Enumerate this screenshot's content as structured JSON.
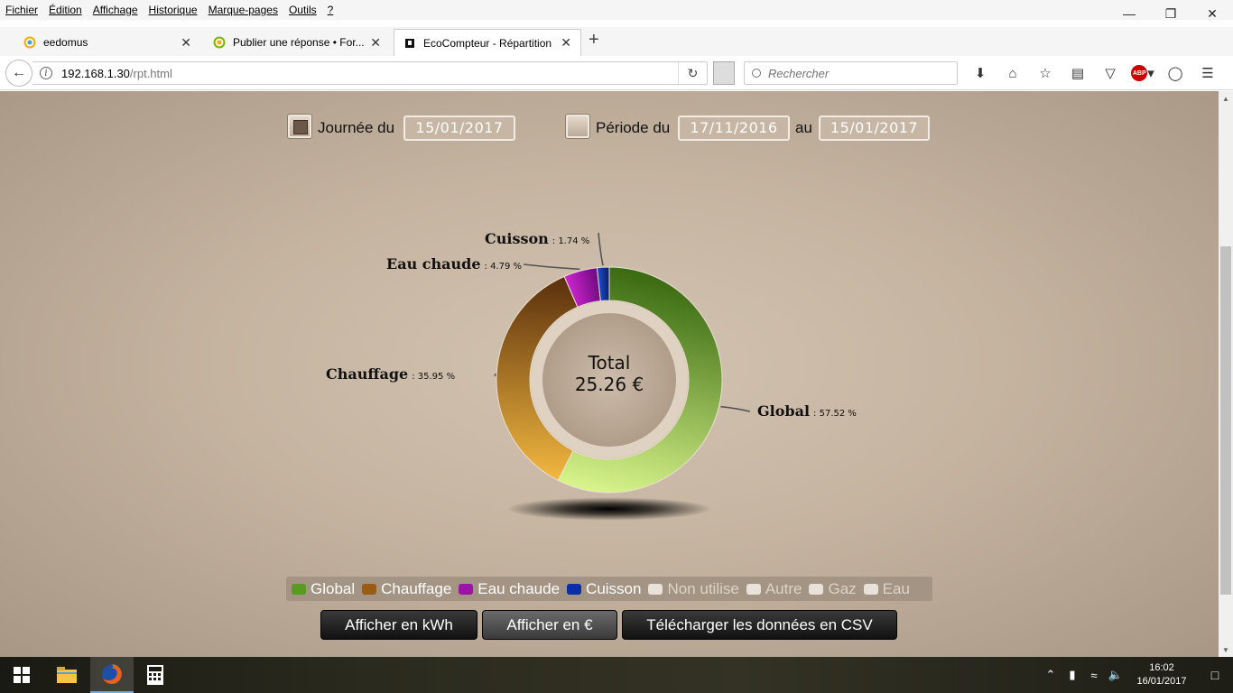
{
  "menu": [
    "Fichier",
    "Édition",
    "Affichage",
    "Historique",
    "Marque-pages",
    "Outils",
    "?"
  ],
  "tabs": [
    {
      "title": "eedomus",
      "icon": "eedomus-icon"
    },
    {
      "title": "Publier une réponse • For...",
      "icon": "forum-icon"
    },
    {
      "title": "EcoCompteur - Répartition",
      "icon": "ecocompteur-icon",
      "active": true
    }
  ],
  "url": {
    "host": "192.168.1.30",
    "path": "/rpt.html"
  },
  "search": {
    "placeholder": "Rechercher"
  },
  "filters": {
    "day": {
      "label": "Journée du",
      "date": "15/01/2017",
      "checked": true
    },
    "period": {
      "label": "Période du",
      "from": "17/11/2016",
      "to_label": "au",
      "to": "15/01/2017",
      "checked": false
    }
  },
  "chart_data": {
    "type": "pie",
    "center_title": "Total",
    "center_value": "25.26 €",
    "slices": [
      {
        "name": "Global",
        "value": 57.52,
        "display": ": 57.52 %",
        "color_start": "#3b6b12",
        "color_end": "#d7f38a"
      },
      {
        "name": "Chauffage",
        "value": 35.95,
        "display": ": 35.95 %",
        "color_start": "#f2b840",
        "color_end": "#5a2f0c"
      },
      {
        "name": "Eau chaude",
        "value": 4.79,
        "display": ": 4.79 %",
        "color_start": "#cf25d2",
        "color_end": "#6a0a7a"
      },
      {
        "name": "Cuisson",
        "value": 1.74,
        "display": ": 1.74 %",
        "color_start": "#1d4fd8",
        "color_end": "#0a1c5a"
      }
    ]
  },
  "legend": [
    {
      "label": "Global",
      "color": "#5a9a22",
      "active": true
    },
    {
      "label": "Chauffage",
      "color": "#9a5b14",
      "active": true
    },
    {
      "label": "Eau chaude",
      "color": "#9d12a8",
      "active": true
    },
    {
      "label": "Cuisson",
      "color": "#0a2ea8",
      "active": true
    },
    {
      "label": "Non utilise",
      "color": "#e8e2da",
      "active": false
    },
    {
      "label": "Autre",
      "color": "#e8e2da",
      "active": false
    },
    {
      "label": "Gaz",
      "color": "#e8e2da",
      "active": false
    },
    {
      "label": "Eau",
      "color": "#e8e2da",
      "active": false
    }
  ],
  "buttons": {
    "kwh": "Afficher en kWh",
    "euro": "Afficher en €",
    "csv": "Télécharger les données en CSV"
  },
  "taskbar": {
    "time": "16:02",
    "date": "16/01/2017"
  }
}
